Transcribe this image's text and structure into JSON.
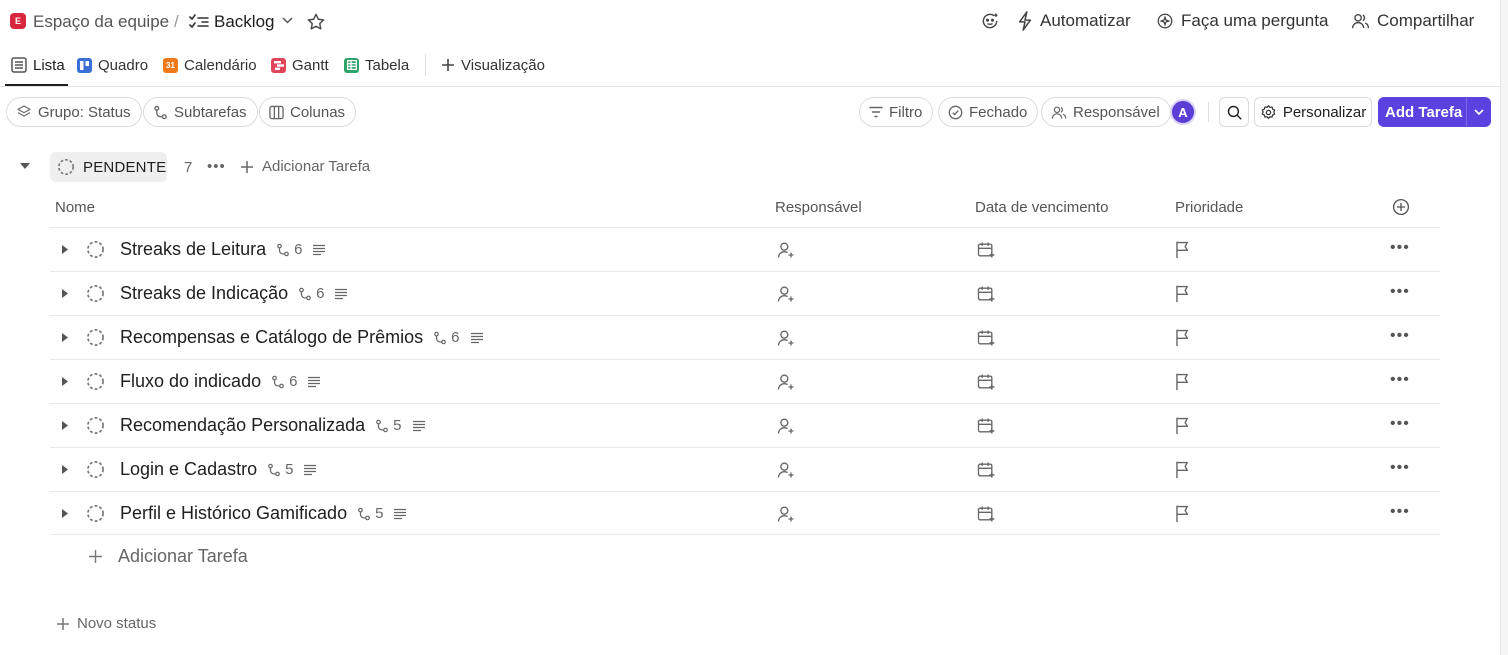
{
  "breadcrumb": {
    "workspace_badge": "E",
    "space": "Espaço da equipe",
    "separator": "/",
    "current": "Backlog"
  },
  "header_actions": {
    "automate": "Automatizar",
    "ask": "Faça uma pergunta",
    "share": "Compartilhar"
  },
  "tabs": [
    {
      "label": "Lista",
      "color": "#555555"
    },
    {
      "label": "Quadro",
      "color": "#3b6fd8"
    },
    {
      "label": "Calendário",
      "color": "#f07a1a",
      "badge": "31"
    },
    {
      "label": "Gantt",
      "color": "#e2445c"
    },
    {
      "label": "Tabela",
      "color": "#2ea36a"
    },
    {
      "label": "Visualização"
    }
  ],
  "filters": {
    "group": "Grupo: Status",
    "subtasks": "Subtarefas",
    "columns": "Colunas",
    "filter": "Filtro",
    "closed": "Fechado",
    "assignee": "Responsável",
    "avatar_initial": "A",
    "customize": "Personalizar",
    "add_task": "Add Tarefa"
  },
  "group": {
    "status": "PENDENTE",
    "count": "7",
    "add_task": "Adicionar Tarefa"
  },
  "columns": {
    "name": "Nome",
    "assignee": "Responsável",
    "due": "Data de vencimento",
    "priority": "Prioridade"
  },
  "tasks": [
    {
      "name": "Streaks de Leitura",
      "subtasks": "6"
    },
    {
      "name": "Streaks de Indicação",
      "subtasks": "6"
    },
    {
      "name": "Recompensas e Catálogo de Prêmios",
      "subtasks": "6"
    },
    {
      "name": "Fluxo do indicado",
      "subtasks": "6"
    },
    {
      "name": "Recomendação Personalizada",
      "subtasks": "5"
    },
    {
      "name": "Login e Cadastro",
      "subtasks": "5"
    },
    {
      "name": "Perfil e Histórico Gamificado",
      "subtasks": "5"
    }
  ],
  "footer": {
    "add_task": "Adicionar Tarefa",
    "new_status": "Novo status"
  },
  "colors": {
    "accent": "#5b42e0",
    "workspace": "#d7263d"
  }
}
